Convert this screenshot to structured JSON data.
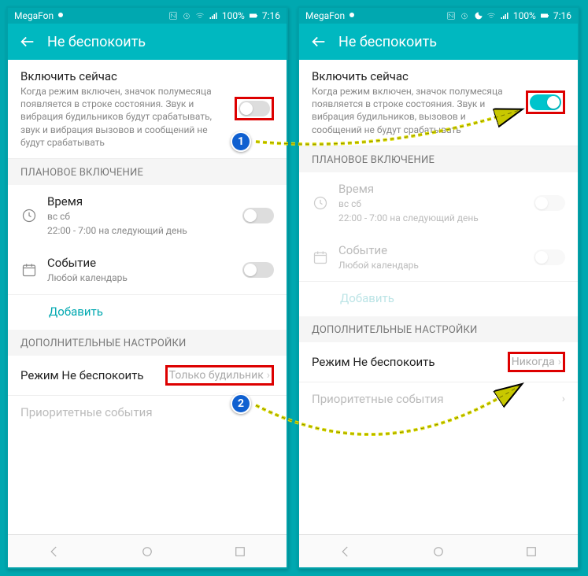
{
  "status": {
    "carrier": "MegaFon",
    "battery": "100%",
    "time": "7:16"
  },
  "title": "Не беспокоить",
  "left": {
    "main": {
      "title": "Включить сейчас",
      "desc": "Когда режим включен, значок полумесяца появляется в строке состояния. Звук и вибрация будильников будут срабатывать, звук и вибрация вызовов и сообщений не будут срабатывать",
      "toggle_on": false
    },
    "section_schedule": "ПЛАНОВОЕ ВКЛЮЧЕНИЕ",
    "time_row": {
      "title": "Время",
      "sub1": "вс сб",
      "sub2": "22:00 - 7:00 на следующий день"
    },
    "event_row": {
      "title": "Событие",
      "sub": "Любой календарь"
    },
    "add": "Добавить",
    "section_extra": "ДОПОЛНИТЕЛЬНЫЕ НАСТРОЙКИ",
    "mode_row": {
      "title": "Режим Не беспокоить",
      "value": "Только будильник"
    },
    "priority_row": "Приоритетные события"
  },
  "right": {
    "main": {
      "title": "Включить сейчас",
      "desc": "Когда режим включен, значок полумесяца появляется в строке состояния. Звук и вибрация будильников, вызовов и сообщений не будут срабатывать",
      "toggle_on": true
    },
    "section_schedule": "ПЛАНОВОЕ ВКЛЮЧЕНИЕ",
    "time_row": {
      "title": "Время",
      "sub1": "вс сб",
      "sub2": "22:00 - 7:00 на следующий день"
    },
    "event_row": {
      "title": "Событие",
      "sub": "Любой календарь"
    },
    "add": "Добавить",
    "section_extra": "ДОПОЛНИТЕЛЬНЫЕ НАСТРОЙКИ",
    "mode_row": {
      "title": "Режим Не беспокоить",
      "value": "Никогда"
    },
    "priority_row": "Приоритетные события"
  },
  "badges": {
    "one": "1",
    "two": "2"
  }
}
